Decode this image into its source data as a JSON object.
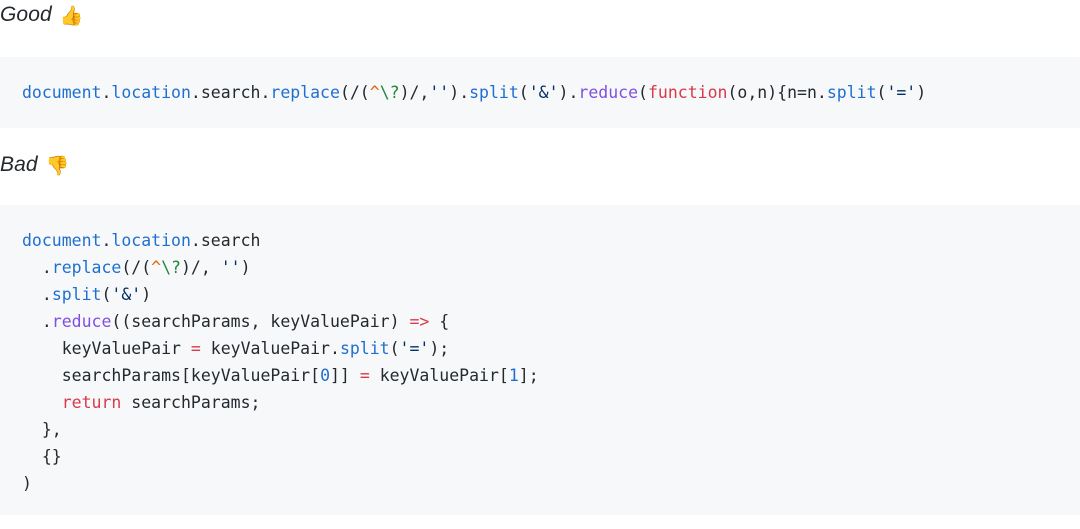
{
  "sections": [
    {
      "caption_text": "Good",
      "caption_emoji": "👍",
      "code_lines": [
        "document.location.search.replace(/(^\\?)/,'').split('&').reduce(function(o,n){n=n.split('=')"
      ]
    },
    {
      "caption_text": "Bad",
      "caption_emoji": "👎",
      "code_lines": [
        "document.location.search",
        "  .replace(/(^\\?)/, '')",
        "  .split('&')",
        "  .reduce((searchParams, keyValuePair) => {",
        "    keyValuePair = keyValuePair.split('=');",
        "    searchParams[keyValuePair[0]] = keyValuePair[1];",
        "    return searchParams;",
        "  },",
        "  {}",
        ")"
      ]
    }
  ],
  "colors": {
    "page_background": "#ffffff",
    "code_background": "#f6f8fa",
    "text": "#24292e",
    "property": "#1f6fd0",
    "function": "#8250df",
    "keyword": "#d73a49",
    "string": "#032f62",
    "number": "#1f6fd0",
    "operator": "#d73a49",
    "regex_anchor": "#e36209",
    "regex_escape": "#22863a"
  },
  "tokens": {
    "document": "document",
    "dot": ".",
    "location": "location",
    "search": "search",
    "replace": "replace",
    "split": "split",
    "reduce": "reduce",
    "function_kw": "function",
    "return_kw": "return",
    "arrow": "=>",
    "assign": "=",
    "caret": "^",
    "escaped_question": "\\?",
    "amp_string": "'&'",
    "eq_string": "'='",
    "empty_string": "''",
    "zero": "0",
    "one": "1",
    "searchParams": "searchParams",
    "keyValuePair": "keyValuePair",
    "o": "o",
    "n": "n"
  }
}
